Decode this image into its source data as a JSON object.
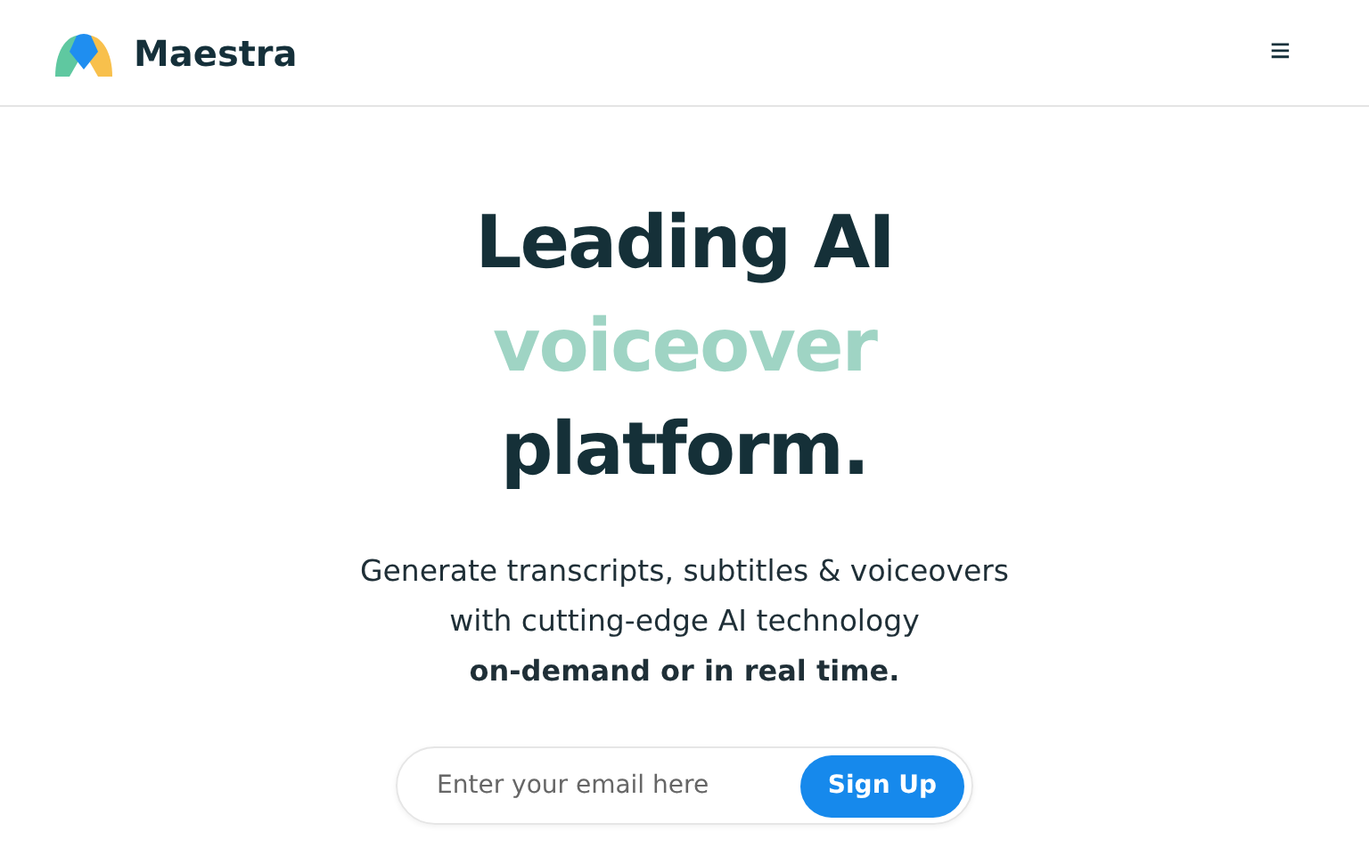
{
  "header": {
    "brand": "Maestra",
    "menu_icon": "≡"
  },
  "hero": {
    "headline": [
      {
        "text": "Leading AI",
        "kind": "solid"
      },
      {
        "text": "voiceover",
        "kind": "faded"
      },
      {
        "text": "platform.",
        "kind": "solid"
      }
    ],
    "subtitle_lines": [
      "Generate transcripts, subtitles & voiceovers",
      "with cutting-edge AI technology"
    ],
    "subtitle_bold": "on-demand or in real time.",
    "signup": {
      "placeholder": "Enter your email here",
      "button": "Sign Up"
    }
  }
}
